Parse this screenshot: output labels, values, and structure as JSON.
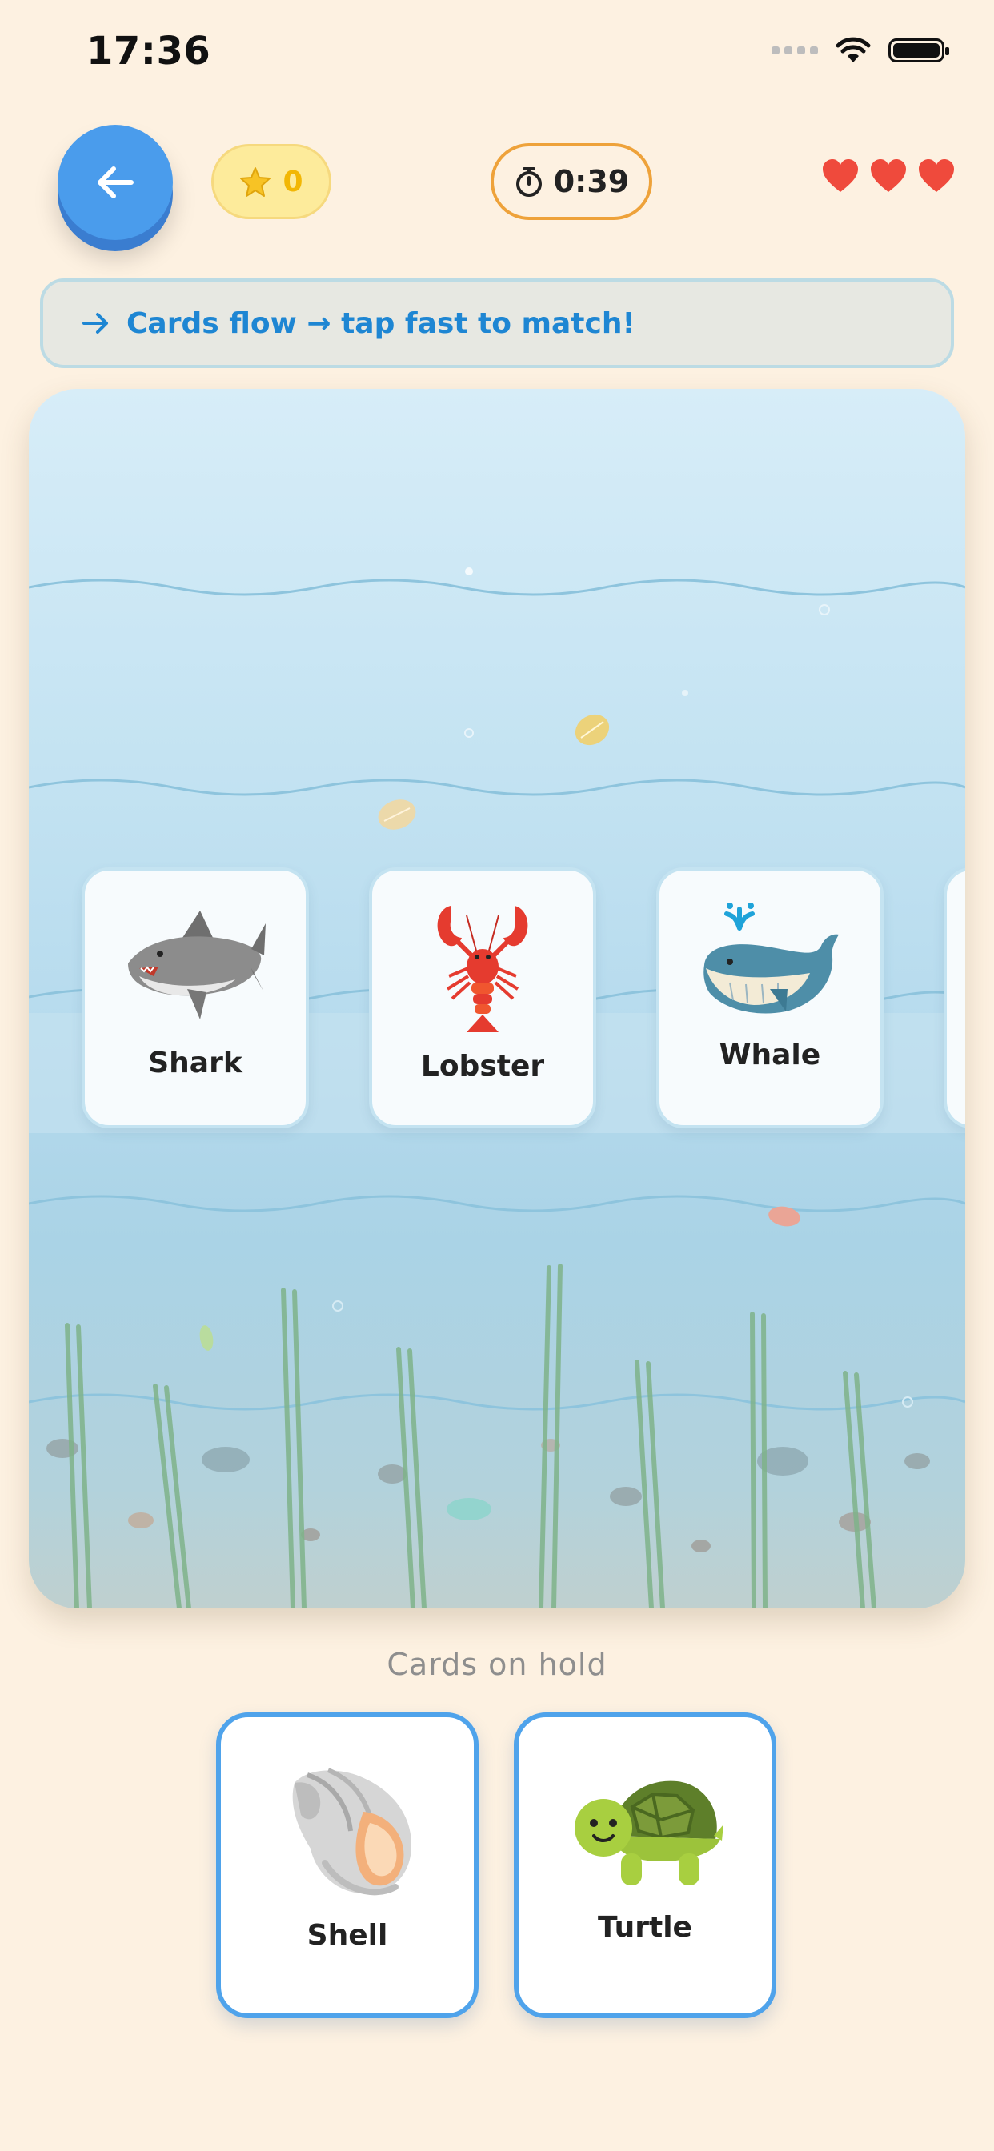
{
  "status_bar": {
    "time": "17:36"
  },
  "header": {
    "score": "0",
    "timer": "0:39",
    "lives": 3
  },
  "hint": {
    "text": "Cards flow → tap fast to match!"
  },
  "flow_cards": [
    {
      "label": "Shark",
      "icon": "shark-icon"
    },
    {
      "label": "Lobster",
      "icon": "lobster-icon"
    },
    {
      "label": "Whale",
      "icon": "whale-icon"
    }
  ],
  "hold": {
    "title": "Cards on hold",
    "cards": [
      {
        "label": "Shell",
        "icon": "shell-icon"
      },
      {
        "label": "Turtle",
        "icon": "turtle-icon"
      }
    ]
  },
  "colors": {
    "background": "#fdf1e1",
    "accent_blue": "#4a9cec",
    "hold_border": "#4fa3eb",
    "timer_border": "#eea23a",
    "heart": "#ef4a3c",
    "star": "#f2b705"
  }
}
